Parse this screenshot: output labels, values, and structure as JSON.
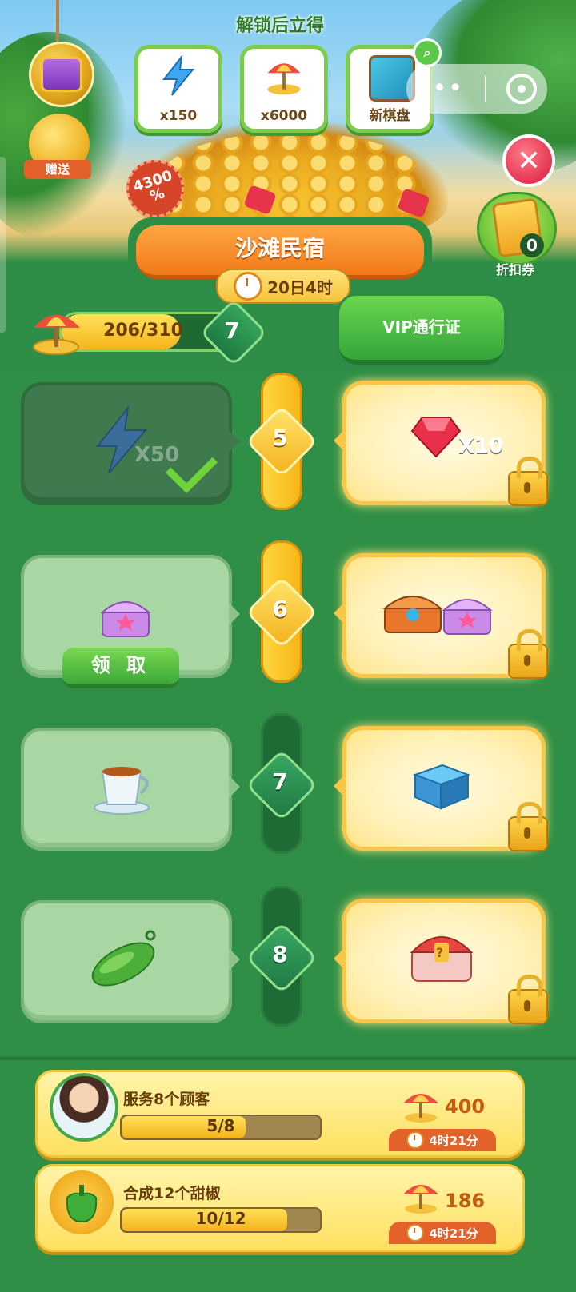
{
  "header": {
    "unlock_title": "解锁后立得",
    "rewards": [
      {
        "icon": "energy-bolt-icon",
        "label": "x150"
      },
      {
        "icon": "beach-umbrella-icon",
        "label": "x6000"
      },
      {
        "icon": "new-board-icon",
        "label": "新棋盘"
      }
    ],
    "gift_label": "赠送",
    "discount_badge": "4300\n%",
    "coupon_count": "0",
    "coupon_label": "折扣券"
  },
  "event": {
    "title": "沙滩民宿",
    "timer": "20日4时",
    "progress_text": "206/310",
    "progress_fraction": 0.665,
    "level": "7",
    "vip_button": "VIP通行证"
  },
  "track": {
    "rows": [
      {
        "level": "5",
        "free_item": "energy-bolt-icon",
        "free_qty": "X50",
        "free_claimed": true,
        "vip_item": "red-gem-icon",
        "vip_qty": "X10"
      },
      {
        "level": "6",
        "free_item": "purple-chest-icon",
        "claim_label": "领 取",
        "vip_item": "chest-pair-icon"
      },
      {
        "level": "7",
        "free_item": "tea-cup-icon",
        "vip_item": "blue-box-icon"
      },
      {
        "level": "8",
        "free_item": "cucumber-icon",
        "vip_item": "mystery-chest-icon"
      }
    ]
  },
  "tasks": [
    {
      "title": "服务8个顾客",
      "progress": "5/8",
      "fraction": 0.625,
      "reward": "400",
      "timer": "4时21分"
    },
    {
      "title": "合成12个甜椒",
      "progress": "10/12",
      "fraction": 0.833,
      "reward": "186",
      "timer": "4时21分"
    }
  ],
  "colors": {
    "background_green": "#2f8a45",
    "vip_gold": "#f9c64a",
    "accent_orange": "#f07a17"
  }
}
